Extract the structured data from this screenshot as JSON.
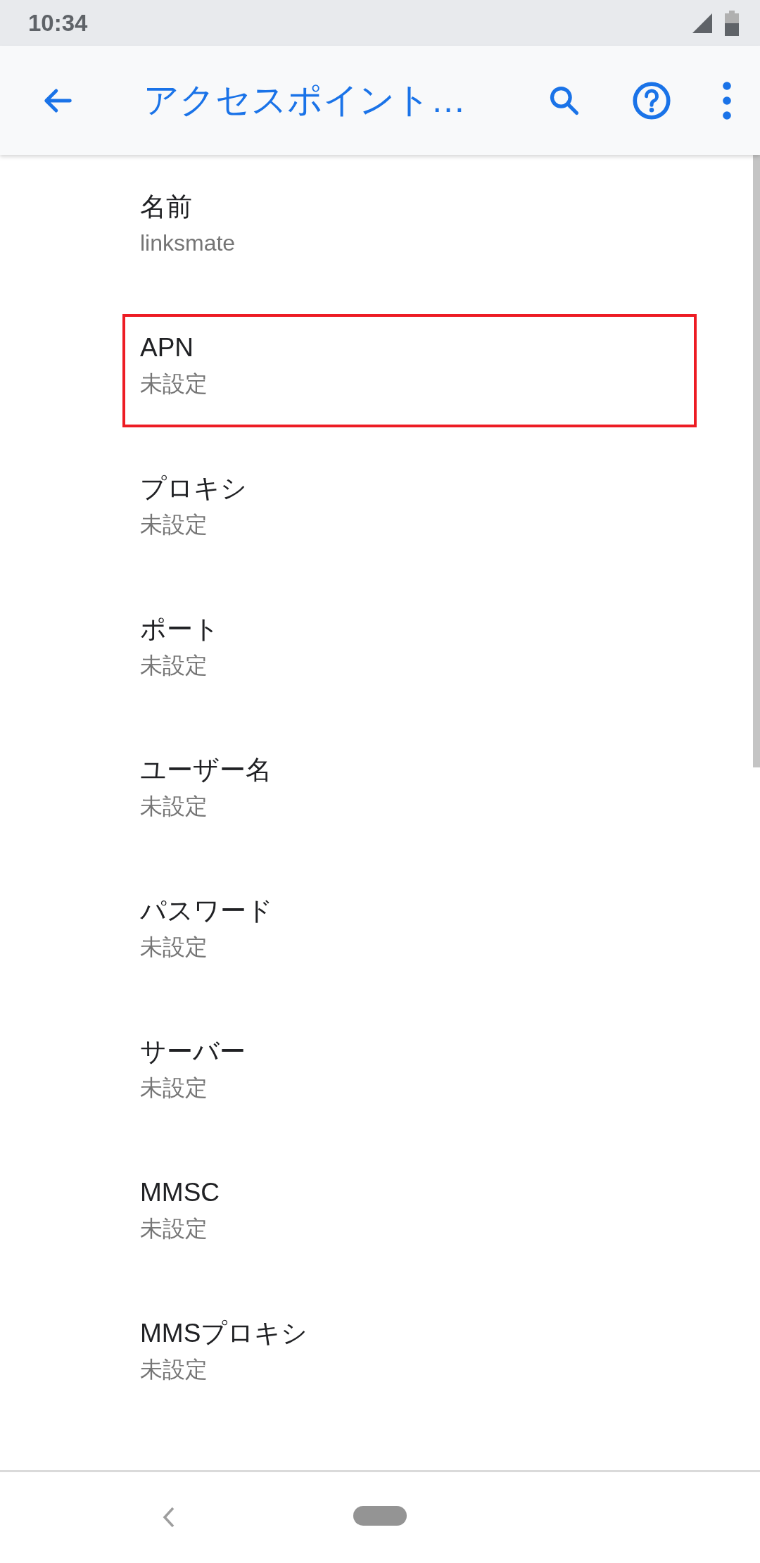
{
  "status_bar": {
    "time": "10:34"
  },
  "toolbar": {
    "title": "アクセスポイント…"
  },
  "items": [
    {
      "title": "名前",
      "summary": "linksmate",
      "highlighted": false
    },
    {
      "title": "APN",
      "summary": "未設定",
      "highlighted": true
    },
    {
      "title": "プロキシ",
      "summary": "未設定",
      "highlighted": false
    },
    {
      "title": "ポート",
      "summary": "未設定",
      "highlighted": false
    },
    {
      "title": "ユーザー名",
      "summary": "未設定",
      "highlighted": false
    },
    {
      "title": "パスワード",
      "summary": "未設定",
      "highlighted": false
    },
    {
      "title": "サーバー",
      "summary": "未設定",
      "highlighted": false
    },
    {
      "title": "MMSC",
      "summary": "未設定",
      "highlighted": false
    },
    {
      "title": "MMSプロキシ",
      "summary": "未設定",
      "highlighted": false
    }
  ]
}
